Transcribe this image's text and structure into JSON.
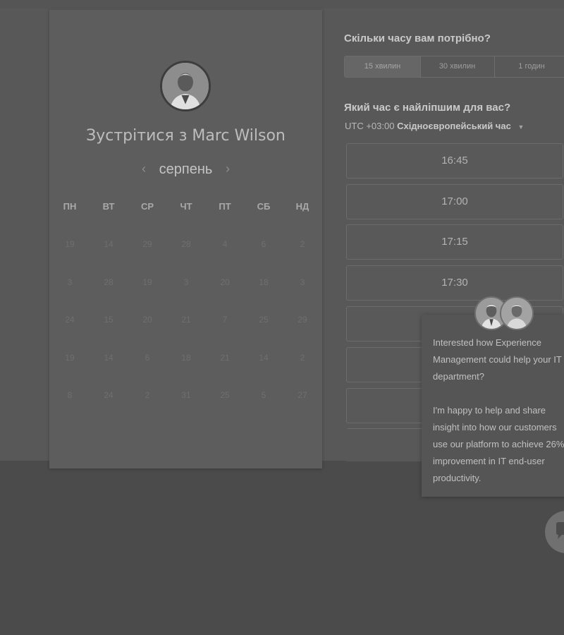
{
  "calendar": {
    "meet_title": "Зустрітися з Marc Wilson",
    "month": "серпень",
    "weekdays": [
      "ПН",
      "ВТ",
      "СР",
      "ЧТ",
      "ПТ",
      "СБ",
      "НД"
    ],
    "days": [
      [
        "19",
        "14",
        "29",
        "28",
        "4",
        "6",
        "2"
      ],
      [
        "3",
        "28",
        "19",
        "3",
        "20",
        "18",
        "3"
      ],
      [
        "24",
        "15",
        "20",
        "21",
        "7",
        "25",
        "29"
      ],
      [
        "19",
        "14",
        "6",
        "18",
        "21",
        "14",
        "2"
      ],
      [
        "8",
        "24",
        "2",
        "31",
        "25",
        "5",
        "27"
      ]
    ]
  },
  "booking": {
    "question_duration": "Скільки часу вам потрібно?",
    "durations": [
      "15 хвилин",
      "30 хвилин",
      "1 годин"
    ],
    "selected_duration": "15 хвилин",
    "question_time": "Який час є найліпшим для вас?",
    "timezone_offset": "UTC +03:00",
    "timezone_name": "Східноєвропейський час",
    "time_slots": [
      "16:45",
      "17:00",
      "17:15",
      "17:30",
      "",
      "",
      ""
    ]
  },
  "chat": {
    "message_1": "Interested how Experience Management could help your IT department?",
    "message_2": "I'm happy to help and share insight into how our customers use our platform to achieve 26% improvement in IT end-user productivity."
  }
}
